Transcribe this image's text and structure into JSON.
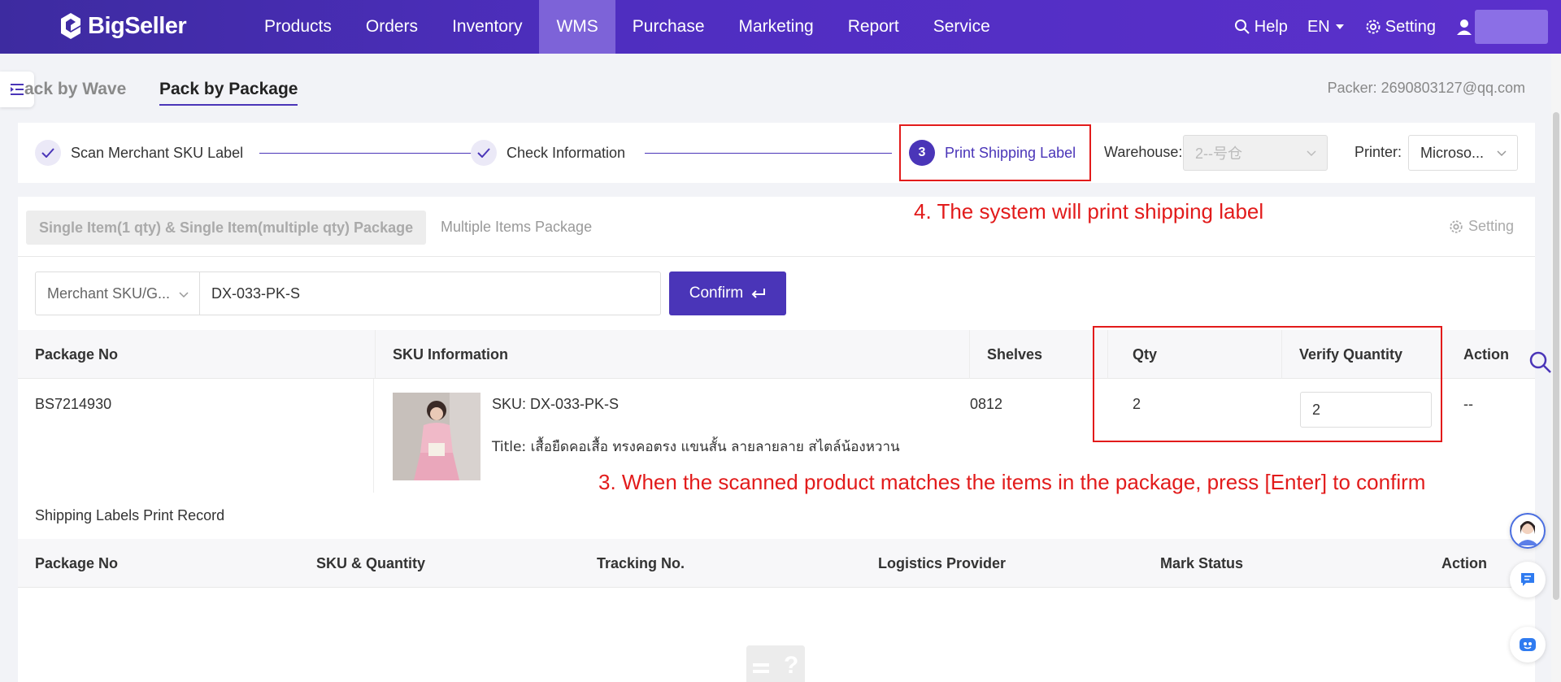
{
  "nav": {
    "brand": "BigSeller",
    "items": [
      "Products",
      "Orders",
      "Inventory",
      "WMS",
      "Purchase",
      "Marketing",
      "Report",
      "Service"
    ],
    "active": "WMS",
    "help": "Help",
    "language": "EN",
    "setting": "Setting"
  },
  "tabs": {
    "wave": "ack by Wave",
    "package": "Pack by Package"
  },
  "packer": "Packer: 2690803127@qq.com",
  "steps": {
    "step1": "Scan Merchant SKU Label",
    "step2": "Check Information",
    "step3_num": "3",
    "step3": "Print Shipping Label",
    "warehouse_label": "Warehouse:",
    "warehouse_value": "2--号仓",
    "printer_label": "Printer:",
    "printer_value": "Microso..."
  },
  "mode": {
    "active": "Single Item(1 qty) & Single Item(multiple qty) Package",
    "other": "Multiple Items Package",
    "setting": "Setting"
  },
  "annotations": {
    "a4": "4. The system will print shipping label",
    "a3": "3. When the scanned product matches the items in the package, press [Enter] to confirm"
  },
  "scan": {
    "type": "Merchant SKU/G...",
    "value": "DX-033-PK-S",
    "confirm": "Confirm"
  },
  "table": {
    "headers": [
      "Package No",
      "SKU Information",
      "Shelves",
      "Qty",
      "Verify Quantity",
      "Action"
    ],
    "row": {
      "package_no": "BS7214930",
      "sku": "SKU: DX-033-PK-S",
      "title": "Title: เสื้อยืดคอเสื้อ ทรงคอตรง แขนสั้น ลายลายลาย สไตล์น้องหวาน",
      "shelves": "0812",
      "qty": "2",
      "verify": "2",
      "action": "--"
    }
  },
  "record": {
    "title": "Shipping Labels Print Record",
    "headers": [
      "Package No",
      "SKU & Quantity",
      "Tracking No.",
      "Logistics Provider",
      "Mark Status",
      "Action"
    ]
  },
  "colors": {
    "primary": "#4a35b8",
    "annotation": "#e21b1b"
  }
}
